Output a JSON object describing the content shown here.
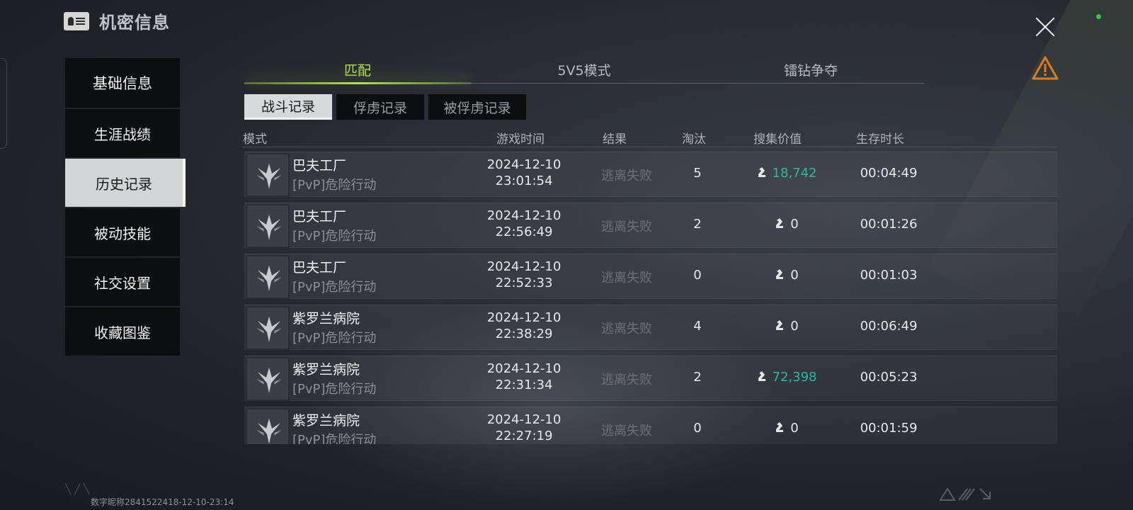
{
  "header": {
    "title": "机密信息",
    "icon": "id-card-icon"
  },
  "sidebar": {
    "items": [
      {
        "label": "基础信息"
      },
      {
        "label": "生涯战绩"
      },
      {
        "label": "历史记录",
        "active": true
      },
      {
        "label": "被动技能"
      },
      {
        "label": "社交设置"
      },
      {
        "label": "收藏图鉴"
      }
    ]
  },
  "tabs": [
    {
      "label": "匹配",
      "active": true
    },
    {
      "label": "5V5模式"
    },
    {
      "label": "镭钻争夺"
    }
  ],
  "subtabs": [
    {
      "label": "战斗记录",
      "active": true
    },
    {
      "label": "俘虏记录"
    },
    {
      "label": "被俘虏记录"
    }
  ],
  "table": {
    "headers": {
      "mode": "模式",
      "time": "游戏时间",
      "result": "结果",
      "kills": "淘汰",
      "value": "搜集价值",
      "duration": "生存时长"
    },
    "rows": [
      {
        "map": "巴夫工厂",
        "mode": "[PvP]危险行动",
        "date": "2024-12-10",
        "time": "23:01:54",
        "result": "逃离失败",
        "kills": "5",
        "value": "18,742",
        "duration": "00:04:49"
      },
      {
        "map": "巴夫工厂",
        "mode": "[PvP]危险行动",
        "date": "2024-12-10",
        "time": "22:56:49",
        "result": "逃离失败",
        "kills": "2",
        "value": "0",
        "duration": "00:01:26"
      },
      {
        "map": "巴夫工厂",
        "mode": "[PvP]危险行动",
        "date": "2024-12-10",
        "time": "22:52:33",
        "result": "逃离失败",
        "kills": "0",
        "value": "0",
        "duration": "00:01:03"
      },
      {
        "map": "紫罗兰病院",
        "mode": "[PvP]危险行动",
        "date": "2024-12-10",
        "time": "22:38:29",
        "result": "逃离失败",
        "kills": "4",
        "value": "0",
        "duration": "00:06:49"
      },
      {
        "map": "紫罗兰病院",
        "mode": "[PvP]危险行动",
        "date": "2024-12-10",
        "time": "22:31:34",
        "result": "逃离失败",
        "kills": "2",
        "value": "72,398",
        "duration": "00:05:23"
      },
      {
        "map": "紫罗兰病院",
        "mode": "[PvP]危险行动",
        "date": "2024-12-10",
        "time": "22:27:19",
        "result": "逃离失败",
        "kills": "0",
        "value": "0",
        "duration": "00:01:59"
      }
    ]
  },
  "footer": {
    "player_id": "数字昵称2841522418-12-10-23:14"
  },
  "colors": {
    "accent": "#b6e04a",
    "value_highlight": "#2db8a0",
    "warning": "#e07a1f",
    "online": "#3ec24a"
  }
}
